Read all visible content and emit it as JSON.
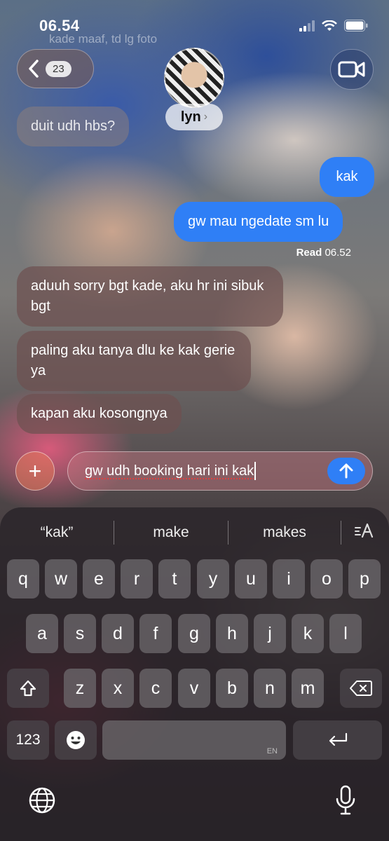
{
  "status": {
    "time": "06.54"
  },
  "header": {
    "ghost_preview": "kade maaf, td lg foto",
    "back_count": "23",
    "contact_name": "lyn",
    "chevron": "›"
  },
  "messages": [
    {
      "type": "received",
      "text": "duit udh hbs?"
    },
    {
      "type": "sent",
      "text": "kak"
    },
    {
      "type": "sent",
      "text": "gw mau ngedate sm lu"
    },
    {
      "type": "received",
      "text": "aduuh sorry bgt kade, aku hr ini sibuk bgt"
    },
    {
      "type": "received",
      "text": "paling aku tanya dlu ke kak gerie ya"
    },
    {
      "type": "received",
      "text": "kapan aku kosongnya"
    }
  ],
  "read_receipt": {
    "label": "Read",
    "time": "06.52"
  },
  "composer": {
    "text": "gw udh booking hari ini kak",
    "plus": "+"
  },
  "keyboard": {
    "suggestions": [
      "“kak”",
      "make",
      "makes"
    ],
    "row1": [
      "q",
      "w",
      "e",
      "r",
      "t",
      "y",
      "u",
      "i",
      "o",
      "p"
    ],
    "row2": [
      "a",
      "s",
      "d",
      "f",
      "g",
      "h",
      "j",
      "k",
      "l"
    ],
    "row3": [
      "z",
      "x",
      "c",
      "v",
      "b",
      "n",
      "m"
    ],
    "numbers_label": "123",
    "space_lang": "EN"
  },
  "colors": {
    "sent_bubble": "#2f7ff6",
    "send_button": "#2f7ff6"
  },
  "icons": [
    "back-chevron-icon",
    "video-camera-icon",
    "signal-icon",
    "wifi-icon",
    "battery-icon",
    "send-arrow-icon",
    "format-text-icon",
    "shift-icon",
    "backspace-icon",
    "emoji-icon",
    "return-icon",
    "globe-icon",
    "microphone-icon"
  ]
}
